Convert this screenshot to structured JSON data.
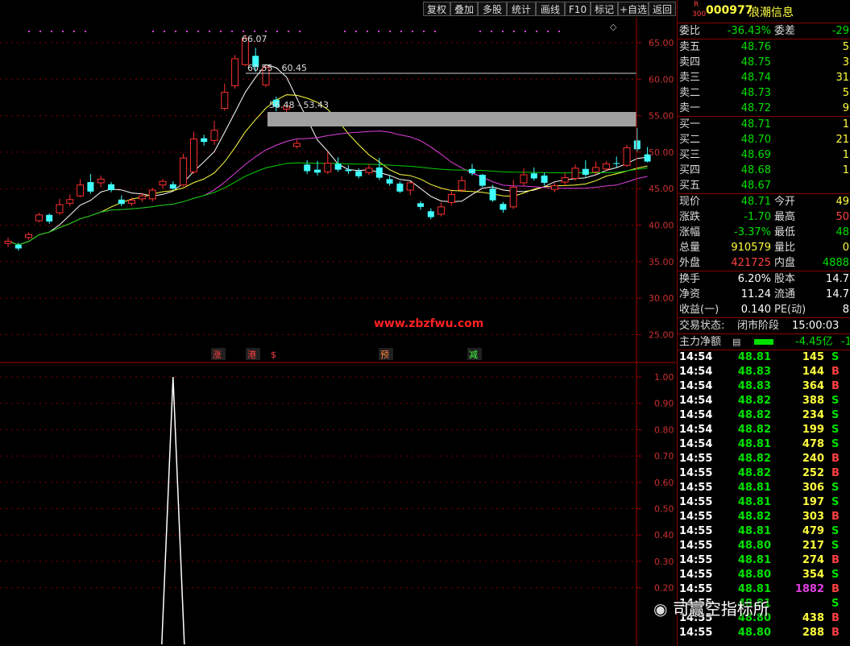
{
  "toolbar": {
    "buttons": [
      "复权",
      "叠加",
      "多股",
      "统计",
      "画线",
      "F10",
      "标记",
      "+自选",
      "返回"
    ]
  },
  "price_chart": {
    "y_ticks": [
      "65.00",
      "60.00",
      "55.00",
      "50.00",
      "45.00",
      "40.00",
      "35.00",
      "30.00",
      "25.00"
    ],
    "annotations": {
      "high": "66.07",
      "range1": "60.55 - 60.45",
      "range2": "56.48 - 53.43"
    },
    "watermark": "www.zbzfwu.com",
    "signals": [
      "涨",
      "港",
      "$",
      "预",
      "减"
    ]
  },
  "indicator_chart": {
    "y_ticks": [
      "1.00",
      "0.90",
      "0.80",
      "0.70",
      "0.60",
      "0.50",
      "0.40",
      "0.30",
      "0.20"
    ]
  },
  "candles": {
    "series": [
      [
        37.5,
        37.8,
        37.0,
        38.3
      ],
      [
        37.3,
        36.8,
        36.5,
        37.6
      ],
      [
        38.3,
        38.7,
        38.0,
        39.0
      ],
      [
        40.6,
        41.4,
        40.4,
        41.7
      ],
      [
        41.4,
        40.5,
        40.2,
        41.6
      ],
      [
        41.7,
        42.8,
        41.4,
        43.6
      ],
      [
        43.0,
        43.5,
        42.6,
        44.2
      ],
      [
        44.0,
        45.5,
        43.8,
        46.3
      ],
      [
        45.9,
        44.6,
        44.3,
        47.0
      ],
      [
        45.8,
        46.3,
        45.2,
        46.8
      ],
      [
        45.6,
        44.8,
        44.5,
        45.9
      ],
      [
        43.5,
        42.9,
        42.6,
        44.1
      ],
      [
        43.0,
        43.4,
        42.6,
        43.8
      ],
      [
        43.6,
        44.0,
        43.2,
        44.4
      ],
      [
        43.6,
        44.8,
        43.2,
        45.1
      ],
      [
        45.5,
        46.0,
        45.0,
        46.3
      ],
      [
        45.6,
        45.0,
        44.8,
        46.0
      ],
      [
        45.5,
        49.2,
        45.3,
        49.8
      ],
      [
        47.3,
        51.8,
        47.0,
        52.8
      ],
      [
        51.9,
        51.4,
        50.9,
        52.4
      ],
      [
        51.6,
        53.0,
        51.0,
        54.3
      ],
      [
        56.0,
        58.2,
        55.7,
        59.4
      ],
      [
        59.1,
        62.8,
        58.7,
        63.3
      ],
      [
        62.0,
        65.6,
        61.8,
        66.07
      ],
      [
        63.2,
        61.7,
        61.0,
        64.3
      ],
      [
        59.2,
        61.6,
        58.9,
        61.8
      ],
      [
        57.2,
        56.2,
        55.6,
        57.6
      ],
      [
        55.9,
        56.3,
        55.0,
        56.5
      ],
      [
        50.8,
        51.2,
        50.5,
        51.7
      ],
      [
        48.3,
        47.4,
        47.0,
        48.9
      ],
      [
        47.6,
        47.2,
        46.8,
        48.8
      ],
      [
        47.3,
        48.5,
        47.0,
        50.0
      ],
      [
        48.4,
        47.6,
        47.3,
        49.3
      ],
      [
        47.6,
        47.4,
        47.0,
        48.2
      ],
      [
        47.4,
        46.7,
        46.4,
        47.8
      ],
      [
        47.2,
        47.8,
        46.9,
        48.4
      ],
      [
        47.9,
        46.5,
        46.2,
        49.2
      ],
      [
        46.3,
        45.7,
        45.4,
        46.8
      ],
      [
        45.7,
        44.6,
        44.4,
        46.0
      ],
      [
        44.8,
        45.8,
        44.1,
        46.0
      ],
      [
        43.0,
        42.5,
        42.1,
        43.3
      ],
      [
        41.9,
        41.1,
        40.8,
        42.3
      ],
      [
        41.5,
        42.5,
        41.2,
        43.1
      ],
      [
        43.1,
        44.2,
        42.7,
        44.7
      ],
      [
        44.8,
        46.1,
        44.5,
        46.7
      ],
      [
        47.7,
        47.1,
        46.8,
        48.4
      ],
      [
        46.9,
        45.4,
        45.2,
        47.0
      ],
      [
        45.0,
        43.4,
        43.2,
        45.5
      ],
      [
        42.9,
        42.1,
        41.7,
        43.2
      ],
      [
        42.5,
        45.2,
        42.2,
        46.2
      ],
      [
        45.8,
        46.9,
        45.4,
        47.8
      ],
      [
        47.1,
        46.4,
        46.1,
        47.9
      ],
      [
        46.8,
        45.8,
        45.4,
        47.2
      ],
      [
        44.9,
        45.4,
        44.5,
        45.8
      ],
      [
        45.9,
        46.5,
        45.4,
        47.2
      ],
      [
        46.4,
        47.8,
        46.1,
        48.3
      ],
      [
        47.7,
        46.9,
        46.6,
        48.9
      ],
      [
        47.3,
        47.9,
        46.9,
        48.7
      ],
      [
        47.7,
        48.4,
        47.4,
        48.8
      ],
      [
        48.5,
        48.4,
        47.9,
        49.4
      ],
      [
        48.2,
        50.6,
        48.0,
        51.0
      ],
      [
        51.6,
        50.4,
        50.1,
        53.3
      ],
      [
        49.7,
        48.71,
        48.6,
        50.7
      ]
    ]
  },
  "indicator_data": {
    "spike_index": 16,
    "spike_value": 1.0
  },
  "right_panel": {
    "header": {
      "badge_top": "R",
      "badge_bottom": "300",
      "code": "000977",
      "name": "浪潮信息"
    },
    "weibi": {
      "label": "委比",
      "value": "-36.43%",
      "label2": "委差",
      "value2": "-29"
    },
    "sells": [
      {
        "label": "卖五",
        "price": "48.76",
        "vol": "5"
      },
      {
        "label": "卖四",
        "price": "48.75",
        "vol": "3"
      },
      {
        "label": "卖三",
        "price": "48.74",
        "vol": "31"
      },
      {
        "label": "卖二",
        "price": "48.73",
        "vol": "5"
      },
      {
        "label": "卖一",
        "price": "48.72",
        "vol": "9"
      }
    ],
    "buys": [
      {
        "label": "买一",
        "price": "48.71",
        "vol": "1"
      },
      {
        "label": "买二",
        "price": "48.70",
        "vol": "21"
      },
      {
        "label": "买三",
        "price": "48.69",
        "vol": "1"
      },
      {
        "label": "买四",
        "price": "48.68",
        "vol": "1"
      },
      {
        "label": "买五",
        "price": "48.67",
        "vol": ""
      }
    ],
    "quote": [
      {
        "l1": "现价",
        "v1": "48.71",
        "l2": "今开",
        "v2": "49"
      },
      {
        "l1": "涨跌",
        "v1": "-1.70",
        "l2": "最高",
        "v2": "50"
      },
      {
        "l1": "涨幅",
        "v1": "-3.37%",
        "l2": "最低",
        "v2": "48"
      },
      {
        "l1": "总量",
        "v1": "910579",
        "l2": "量比",
        "v2": "0"
      },
      {
        "l1": "外盘",
        "v1": "421725",
        "l2": "内盘",
        "v2": "4888"
      }
    ],
    "fund": [
      {
        "l1": "换手",
        "v1": "6.20%",
        "l2": "股本",
        "v2": "14.7"
      },
      {
        "l1": "净资",
        "v1": "11.24",
        "l2": "流通",
        "v2": "14.7"
      },
      {
        "l1": "收益(一)",
        "v1": "0.140",
        "l2": "PE(动)",
        "v2": "8"
      }
    ],
    "status": {
      "label": "交易状态:",
      "value": "闭市阶段",
      "time": "15:00:03"
    },
    "mainforce": {
      "label": "主力净额",
      "value": "-4.45亿",
      "extra": "-1"
    },
    "ticks": [
      {
        "t": "14:54",
        "p": "48.81",
        "v": "145",
        "d": "S"
      },
      {
        "t": "14:54",
        "p": "48.83",
        "v": "144",
        "d": "B"
      },
      {
        "t": "14:54",
        "p": "48.83",
        "v": "364",
        "d": "B"
      },
      {
        "t": "14:54",
        "p": "48.82",
        "v": "388",
        "d": "S"
      },
      {
        "t": "14:54",
        "p": "48.82",
        "v": "234",
        "d": "S"
      },
      {
        "t": "14:54",
        "p": "48.82",
        "v": "199",
        "d": "S"
      },
      {
        "t": "14:54",
        "p": "48.81",
        "v": "478",
        "d": "S"
      },
      {
        "t": "14:55",
        "p": "48.82",
        "v": "240",
        "d": "B"
      },
      {
        "t": "14:55",
        "p": "48.82",
        "v": "252",
        "d": "B"
      },
      {
        "t": "14:55",
        "p": "48.81",
        "v": "306",
        "d": "S"
      },
      {
        "t": "14:55",
        "p": "48.81",
        "v": "197",
        "d": "S"
      },
      {
        "t": "14:55",
        "p": "48.82",
        "v": "303",
        "d": "B"
      },
      {
        "t": "14:55",
        "p": "48.81",
        "v": "479",
        "d": "S"
      },
      {
        "t": "14:55",
        "p": "48.80",
        "v": "217",
        "d": "S"
      },
      {
        "t": "14:55",
        "p": "48.81",
        "v": "274",
        "d": "B"
      },
      {
        "t": "14:55",
        "p": "48.80",
        "v": "354",
        "d": "S"
      },
      {
        "t": "14:55",
        "p": "48.81",
        "v": "1882",
        "d": "B"
      },
      {
        "t": "14:55",
        "p": "48.81",
        "v": "",
        "d": "S"
      },
      {
        "t": "14:55",
        "p": "48.80",
        "v": "438",
        "d": "B"
      },
      {
        "t": "14:55",
        "p": "48.80",
        "v": "288",
        "d": "B"
      }
    ],
    "wechat": "司赢空指标所"
  },
  "colors": {
    "up": "#ff3030",
    "down": "#40ffff",
    "ma5": "#ffffff",
    "ma10": "#ffff40",
    "ma20": "#e040e0",
    "ma60": "#00d000",
    "grid": "#800000"
  }
}
